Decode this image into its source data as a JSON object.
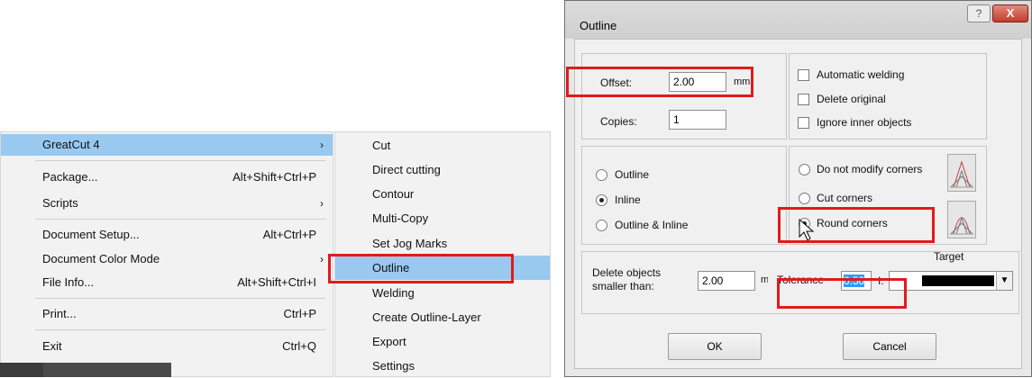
{
  "menu": {
    "items": [
      {
        "label": "GreatCut 4",
        "shortcut": "",
        "submenu": true,
        "highlighted": true
      },
      {
        "label": "Package...",
        "shortcut": "Alt+Shift+Ctrl+P",
        "submenu": false
      },
      {
        "label": "Scripts",
        "shortcut": "",
        "submenu": true
      },
      {
        "label": "Document Setup...",
        "shortcut": "Alt+Ctrl+P",
        "submenu": false
      },
      {
        "label": "Document Color Mode",
        "shortcut": "",
        "submenu": true
      },
      {
        "label": "File Info...",
        "shortcut": "Alt+Shift+Ctrl+I",
        "submenu": false
      },
      {
        "label": "Print...",
        "shortcut": "Ctrl+P",
        "submenu": false
      },
      {
        "label": "Exit",
        "shortcut": "Ctrl+Q",
        "submenu": false
      }
    ],
    "arrow": "›"
  },
  "submenu": {
    "items": [
      "Cut",
      "Direct cutting",
      "Contour",
      "Multi-Copy",
      "Set Jog Marks",
      "Outline",
      "Welding",
      "Create Outline-Layer",
      "Export",
      "Settings"
    ],
    "selected": "Outline"
  },
  "dialog": {
    "title": "Outline",
    "help": "?",
    "close": "X",
    "offset_label": "Offset:",
    "offset_value": "2.00",
    "offset_unit": "mm",
    "copies_label": "Copies:",
    "copies_value": "1",
    "automatic_welding": "Automatic welding",
    "delete_original": "Delete original",
    "ignore_inner": "Ignore inner objects",
    "mode_outline": "Outline",
    "mode_inline": "Inline",
    "mode_both": "Outline & Inline",
    "mode_selected": "Inline",
    "corner_none": "Do not modify corners",
    "corner_cut": "Cut corners",
    "corner_round": "Round corners",
    "corner_selected": "Round corners",
    "target_label": "Target",
    "delete_label_1": "Delete objects",
    "delete_label_2": "smaller than:",
    "delete_value": "2.00",
    "delete_unit": "mm",
    "tolerance_label": "Tolerance",
    "tolerance_value": "0.50",
    "target_value_prefix": "I.",
    "ok": "OK",
    "cancel": "Cancel",
    "colors": {
      "highlight": "#99c9ef",
      "annotation": "#e01b1b",
      "selection": "#3399ff"
    }
  }
}
